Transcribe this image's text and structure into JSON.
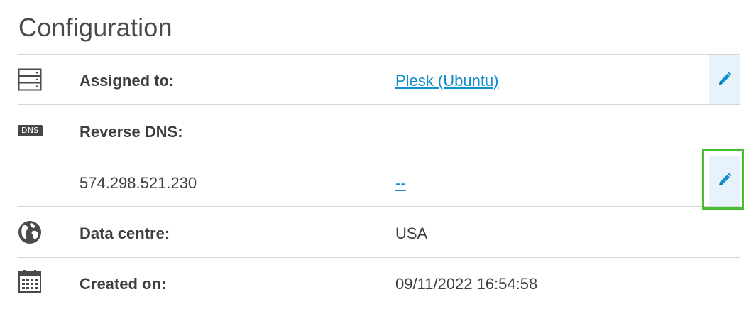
{
  "page": {
    "title": "Configuration"
  },
  "rows": {
    "assigned": {
      "icon": "server-icon",
      "label": "Assigned to:",
      "value": "Plesk (Ubuntu)",
      "edit_icon": "pencil-icon"
    },
    "reverse_dns": {
      "icon": "dns-icon",
      "badge": "DNS",
      "label": "Reverse DNS:",
      "entries": [
        {
          "ip": "574.298.521.230",
          "value": "--",
          "edit_icon": "pencil-icon"
        }
      ]
    },
    "data_centre": {
      "icon": "globe-icon",
      "label": "Data centre:",
      "value": "USA"
    },
    "created_on": {
      "icon": "calendar-icon",
      "label": "Created on:",
      "value": "09/11/2022 16:54:58"
    }
  },
  "colors": {
    "link": "#0f8fcd",
    "edit_button_bg": "#e6f3fa",
    "highlight": "#43bf2f",
    "divider": "#d6d6d6"
  }
}
